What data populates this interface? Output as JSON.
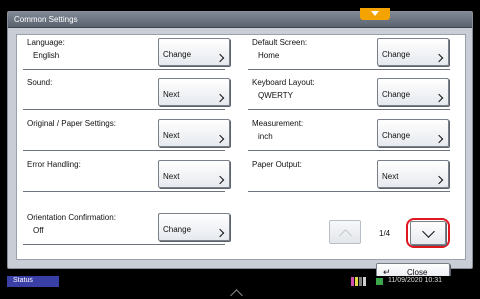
{
  "window": {
    "title": "Common Settings"
  },
  "settings": [
    {
      "label": "Language:",
      "value": "English",
      "button": "Change"
    },
    {
      "label": "Default Screen:",
      "value": "Home",
      "button": "Change"
    },
    {
      "label": "Sound:",
      "value": "",
      "button": "Next"
    },
    {
      "label": "Keyboard Layout:",
      "value": "QWERTY",
      "button": "Change"
    },
    {
      "label": "Original / Paper Settings:",
      "value": "",
      "button": "Next"
    },
    {
      "label": "Measurement:",
      "value": "inch",
      "button": "Change"
    },
    {
      "label": "Error Handling:",
      "value": "",
      "button": "Next"
    },
    {
      "label": "Paper Output:",
      "value": "",
      "button": "Next"
    },
    {
      "label": "Orientation Confirmation:",
      "value": "Off",
      "button": "Change"
    }
  ],
  "pager": {
    "page_text": "1/4",
    "up_icon": "chevron-up-icon",
    "down_icon": "chevron-down-icon",
    "highlight_color": "#e0161e"
  },
  "close_button": {
    "label": "Close",
    "icon": "return-arrow-icon"
  },
  "statusbar": {
    "status_label": "Status",
    "datetime": "11/09/2020  10:31"
  },
  "colors": {
    "title_tab": "#f5a300",
    "status_tab": "#3a3fa6"
  }
}
